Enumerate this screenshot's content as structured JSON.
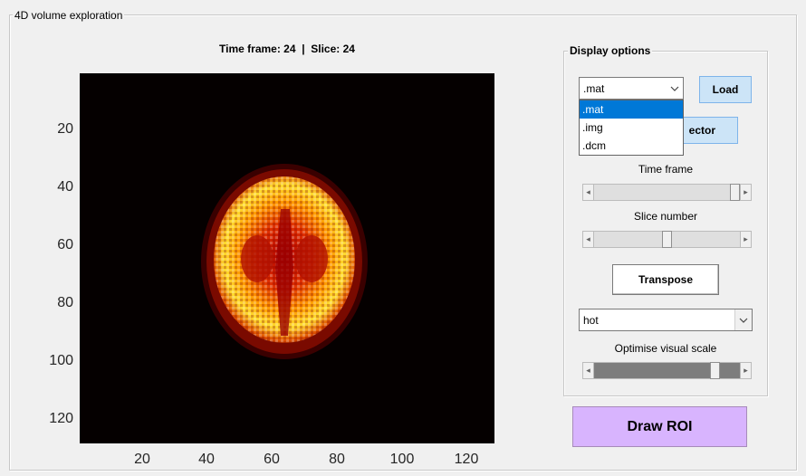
{
  "panel": {
    "title": "4D volume exploration"
  },
  "axes": {
    "title": "Time frame: 24  |  Slice: 24",
    "yticks": [
      "20",
      "40",
      "60",
      "80",
      "100",
      "120"
    ],
    "xticks": [
      "20",
      "40",
      "60",
      "80",
      "100",
      "120"
    ],
    "colormap": "hot"
  },
  "display_options": {
    "title": "Display options",
    "format_select": {
      "value": ".mat",
      "options": [
        ".mat",
        ".img",
        ".dcm"
      ],
      "open": true
    },
    "load_label": "Load",
    "select_button_partial": "ector",
    "time_frame_label": "Time frame",
    "time_frame_level": 1.0,
    "slice_label": "Slice number",
    "slice_level": 0.53,
    "transpose_label": "Transpose",
    "colormap_select": {
      "value": "hot"
    },
    "scale_label": "Optimise visual scale",
    "scale_level": 0.88
  },
  "draw_roi_label": "Draw ROI",
  "colors": {
    "draw_roi_bg": "#d8b4fe",
    "dropdown_selected": "#0078d7",
    "button_blue": "#cce4f7"
  }
}
